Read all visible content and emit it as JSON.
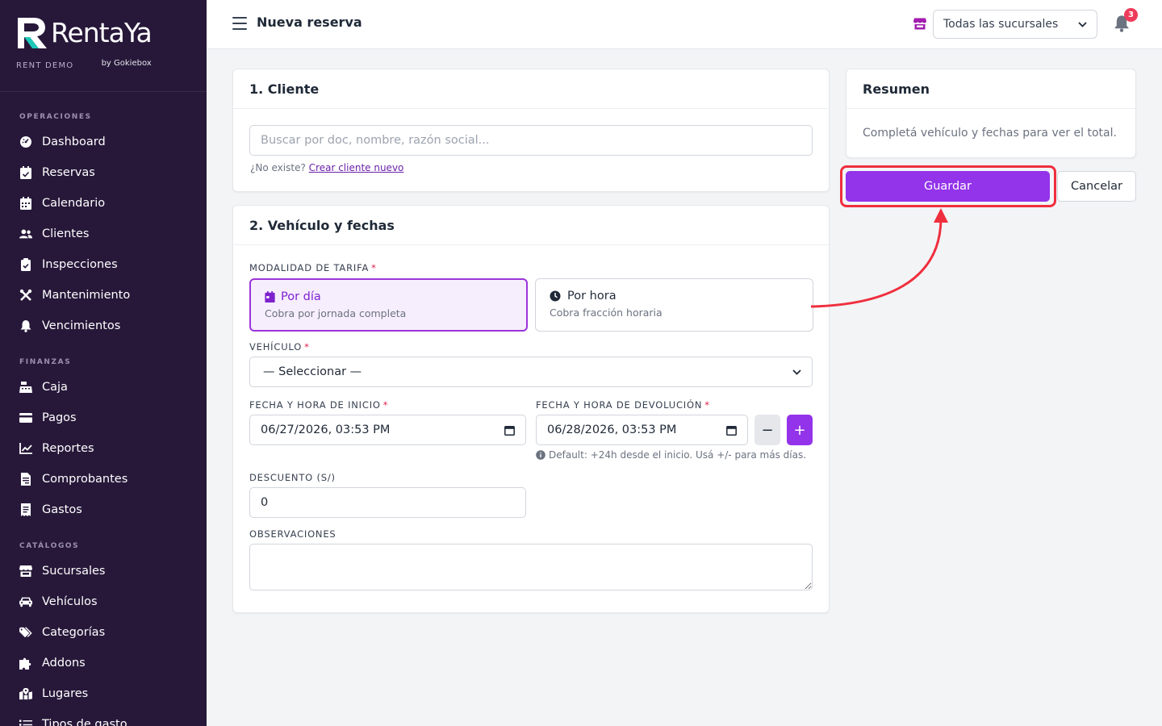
{
  "brand": {
    "name": "RentaYa",
    "byline": "by Gokiebox",
    "tenant": "RENT DEMO"
  },
  "sidebar": {
    "sections": [
      {
        "title": "OPERACIONES",
        "items": [
          {
            "label": "Dashboard",
            "icon": "gauge-icon"
          },
          {
            "label": "Reservas",
            "icon": "calendar-check-icon"
          },
          {
            "label": "Calendario",
            "icon": "calendar-icon"
          },
          {
            "label": "Clientes",
            "icon": "users-icon"
          },
          {
            "label": "Inspecciones",
            "icon": "clipboard-check-icon"
          },
          {
            "label": "Mantenimiento",
            "icon": "tools-icon"
          },
          {
            "label": "Vencimientos",
            "icon": "bell-icon"
          }
        ]
      },
      {
        "title": "FINANZAS",
        "items": [
          {
            "label": "Caja",
            "icon": "cash-register-icon"
          },
          {
            "label": "Pagos",
            "icon": "credit-card-icon"
          },
          {
            "label": "Reportes",
            "icon": "chart-line-icon"
          },
          {
            "label": "Comprobantes",
            "icon": "file-invoice-icon"
          },
          {
            "label": "Gastos",
            "icon": "receipt-icon"
          }
        ]
      },
      {
        "title": "CATÁLOGOS",
        "items": [
          {
            "label": "Sucursales",
            "icon": "store-icon"
          },
          {
            "label": "Vehículos",
            "icon": "car-icon"
          },
          {
            "label": "Categorías",
            "icon": "tags-icon"
          },
          {
            "label": "Addons",
            "icon": "puzzle-icon"
          },
          {
            "label": "Lugares",
            "icon": "map-marked-icon"
          },
          {
            "label": "Tipos de gasto",
            "icon": "list-icon"
          }
        ]
      }
    ]
  },
  "header": {
    "title": "Nueva reserva",
    "branch_selected": "Todas las sucursales",
    "notifications_count": "3"
  },
  "cliente": {
    "title": "1. Cliente",
    "search_placeholder": "Buscar por doc, nombre, razón social...",
    "not_exists": "¿No existe?",
    "create_link": "Crear cliente nuevo"
  },
  "vehiculo": {
    "title": "2. Vehículo y fechas",
    "tarifa_label": "MODALIDAD DE TARIFA",
    "modes": [
      {
        "title": "Por día",
        "subtitle": "Cobra por jornada completa",
        "selected": true
      },
      {
        "title": "Por hora",
        "subtitle": "Cobra fracción horaria",
        "selected": false
      }
    ],
    "vehicle_label": "VEHÍCULO",
    "vehicle_selected": "— Seleccionar —",
    "start_label": "FECHA Y HORA DE INICIO",
    "start_value": "06/27/2026, 03:53 PM",
    "end_label": "FECHA Y HORA DE DEVOLUCIÓN",
    "end_value": "06/28/2026, 03:53 PM",
    "minus": "−",
    "plus": "+",
    "end_hint": "Default: +24h desde el inicio. Usá +/- para más días.",
    "discount_label": "DESCUENTO (S/)",
    "discount_value": "0",
    "notes_label": "OBSERVACIONES"
  },
  "resumen": {
    "title": "Resumen",
    "empty_text": "Completá vehículo y fechas para ver el total."
  },
  "actions": {
    "save": "Guardar",
    "cancel": "Cancelar"
  },
  "colors": {
    "sidebar_bg": "#27183a",
    "accent": "#9333ea",
    "highlight": "#ef2f3e"
  }
}
